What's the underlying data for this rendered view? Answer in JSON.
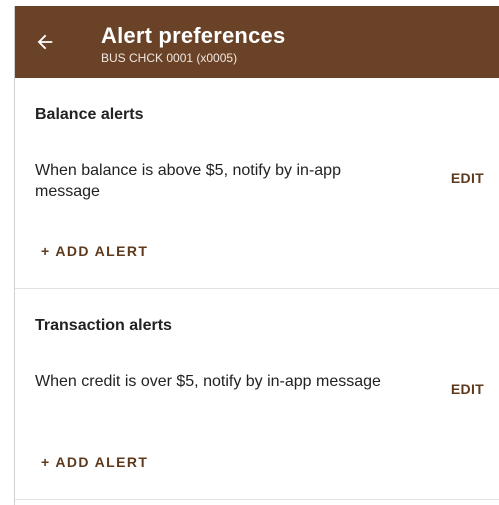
{
  "appbar": {
    "title": "Alert preferences",
    "subtitle": "BUS CHCK 0001 (x0005)",
    "back_icon": "arrow-left-icon",
    "color": "#6a4228"
  },
  "sections": [
    {
      "header": "Balance alerts",
      "rule_text": "When balance is above $5, notify by in-app message",
      "edit_label": "EDIT",
      "add_alert_label": "+ ADD ALERT"
    },
    {
      "header": "Transaction alerts",
      "rule_text": "When credit is over $5, notify by in-app message",
      "edit_label": "EDIT",
      "add_alert_label": "+ ADD ALERT"
    }
  ],
  "colors": {
    "accent": "#5d3a1d",
    "header_bg": "#6a4228"
  }
}
